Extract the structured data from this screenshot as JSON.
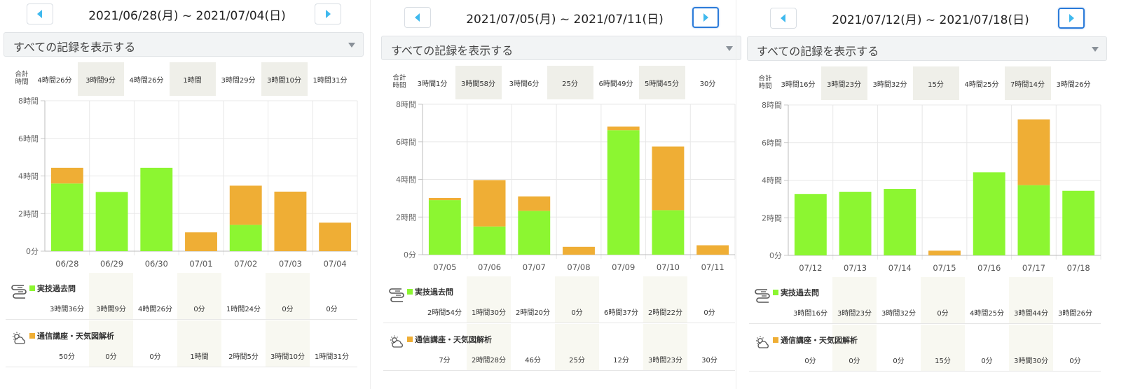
{
  "app": {
    "title": ""
  },
  "colors": {
    "green": "#8cf631",
    "orange": "#efae35",
    "nav_arrow": "#3fb9ee",
    "active_border": "#2b7bd9",
    "shade": "#efefe9"
  },
  "icons": {
    "prev": "triangle-left",
    "next": "triangle-right",
    "practical": "test-sheet-icon",
    "correspondence": "weather-icon"
  },
  "labels": {
    "filter": "すべての記録を表示する",
    "total_heading": [
      "合計",
      "時間"
    ],
    "category1": "実技過去問",
    "category2": "通信講座・天気図解析"
  },
  "weeks": [
    {
      "range": "2021/06/28(月) ~ 2021/07/04(日)",
      "next_active": false,
      "days": [
        "06/28",
        "06/29",
        "06/30",
        "07/01",
        "07/02",
        "07/03",
        "07/04"
      ],
      "totals": [
        "4時間26分",
        "3時間9分",
        "4時間26分",
        "1時間",
        "3時間29分",
        "3時間10分",
        "1時間31分"
      ],
      "cat1": [
        "3時間36分",
        "3時間9分",
        "4時間26分",
        "0分",
        "1時間24分",
        "0分",
        "0分"
      ],
      "cat2": [
        "50分",
        "0分",
        "0分",
        "1時間",
        "2時間5分",
        "3時間10分",
        "1時間31分"
      ],
      "chart_data": {
        "type": "bar",
        "stacked": true,
        "categories": [
          "06/28",
          "06/29",
          "06/30",
          "07/01",
          "07/02",
          "07/03",
          "07/04"
        ],
        "series": [
          {
            "name": "実技過去問",
            "values": [
              216,
              189,
              266,
              0,
              84,
              0,
              0
            ]
          },
          {
            "name": "通信講座・天気図解析",
            "values": [
              50,
              0,
              0,
              60,
              125,
              190,
              91
            ]
          }
        ],
        "ylim": [
          0,
          480
        ],
        "yticks": [
          0,
          120,
          240,
          360,
          480
        ],
        "yticklabels": [
          "0分",
          "2時間",
          "4時間",
          "6時間",
          "8時間"
        ],
        "grid": true
      }
    },
    {
      "range": "2021/07/05(月) ~ 2021/07/11(日)",
      "next_active": true,
      "days": [
        "07/05",
        "07/06",
        "07/07",
        "07/08",
        "07/09",
        "07/10",
        "07/11"
      ],
      "totals": [
        "3時間1分",
        "3時間58分",
        "3時間6分",
        "25分",
        "6時間49分",
        "5時間45分",
        "30分"
      ],
      "cat1": [
        "2時間54分",
        "1時間30分",
        "2時間20分",
        "0分",
        "6時間37分",
        "2時間22分",
        "0分"
      ],
      "cat2": [
        "7分",
        "2時間28分",
        "46分",
        "25分",
        "12分",
        "3時間23分",
        "30分"
      ],
      "chart_data": {
        "type": "bar",
        "stacked": true,
        "categories": [
          "07/05",
          "07/06",
          "07/07",
          "07/08",
          "07/09",
          "07/10",
          "07/11"
        ],
        "series": [
          {
            "name": "実技過去問",
            "values": [
              174,
              90,
              140,
              0,
              397,
              142,
              0
            ]
          },
          {
            "name": "通信講座・天気図解析",
            "values": [
              7,
              148,
              46,
              25,
              12,
              203,
              30
            ]
          }
        ],
        "ylim": [
          0,
          480
        ],
        "yticks": [
          0,
          120,
          240,
          360,
          480
        ],
        "yticklabels": [
          "0分",
          "2時間",
          "4時間",
          "6時間",
          "8時間"
        ],
        "grid": true
      }
    },
    {
      "range": "2021/07/12(月) ~ 2021/07/18(日)",
      "next_active": true,
      "days": [
        "07/12",
        "07/13",
        "07/14",
        "07/15",
        "07/16",
        "07/17",
        "07/18"
      ],
      "totals": [
        "3時間16分",
        "3時間23分",
        "3時間32分",
        "15分",
        "4時間25分",
        "7時間14分",
        "3時間26分"
      ],
      "cat1": [
        "3時間16分",
        "3時間23分",
        "3時間32分",
        "0分",
        "4時間25分",
        "3時間44分",
        "3時間26分"
      ],
      "cat2": [
        "0分",
        "0分",
        "0分",
        "15分",
        "0分",
        "3時間30分",
        "0分"
      ],
      "chart_data": {
        "type": "bar",
        "stacked": true,
        "categories": [
          "07/12",
          "07/13",
          "07/14",
          "07/15",
          "07/16",
          "07/17",
          "07/18"
        ],
        "series": [
          {
            "name": "実技過去問",
            "values": [
              196,
              203,
              212,
              0,
              265,
              224,
              206
            ]
          },
          {
            "name": "通信講座・天気図解析",
            "values": [
              0,
              0,
              0,
              15,
              0,
              210,
              0
            ]
          }
        ],
        "ylim": [
          0,
          480
        ],
        "yticks": [
          0,
          120,
          240,
          360,
          480
        ],
        "yticklabels": [
          "0分",
          "2時間",
          "4時間",
          "6時間",
          "8時間"
        ],
        "grid": true
      }
    }
  ]
}
